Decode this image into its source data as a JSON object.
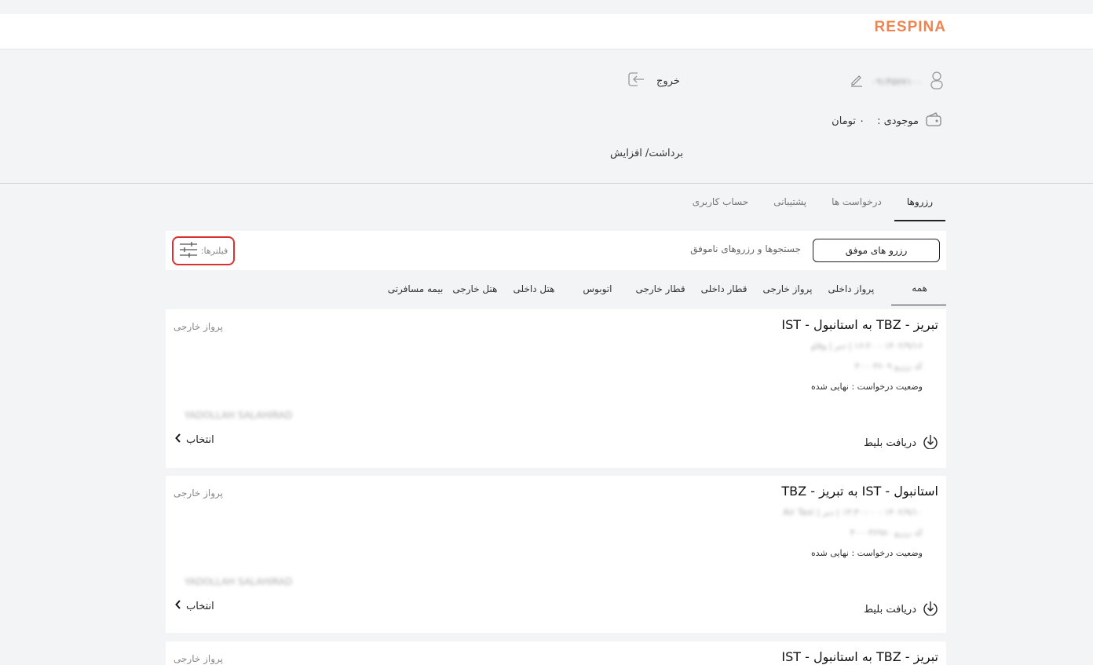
{
  "header": {
    "logo": "RESPINA"
  },
  "profile": {
    "phone": "۰۹۱۴۵۷۷۱۰۰",
    "logout_label": "خروج",
    "wallet_label": "موجودی :",
    "wallet_value": "۰ تومان",
    "withdraw_label": "برداشت/ افزایش"
  },
  "tabs": [
    {
      "label": "رزروها"
    },
    {
      "label": "درخواست ها"
    },
    {
      "label": "پشتیبانی"
    },
    {
      "label": "حساب کاربری"
    }
  ],
  "filterbar": {
    "success_label": "رزرو های موفق",
    "failed_label": "جستجوها و رزروهای ناموفق",
    "filters_label": "فیلترها:"
  },
  "categories": [
    {
      "label": "همه"
    },
    {
      "label": "پرواز داخلی"
    },
    {
      "label": "پرواز خارجی"
    },
    {
      "label": "قطار داخلی"
    },
    {
      "label": "قطار خارجی"
    },
    {
      "label": "اتوبوس"
    },
    {
      "label": "هتل داخلی"
    },
    {
      "label": "هتل خارجی"
    },
    {
      "label": "بیمه مسافرتی"
    }
  ],
  "bookings": [
    {
      "route": "تبریز - TBZ به استانبول - IST",
      "type": "پرواز خارجی",
      "date": "۱۴۰۲/۹/۱۶ - ۱۶:۲۰ | دیر | وقاو",
      "code": "کد رزرو ۳۰۰۰۳۶۰۹",
      "status": "وضعیت درخواست : نهایی شده",
      "passenger": "YADOLLAH SALAHIRAD",
      "select_label": "انتخاب",
      "ticket_label": "دریافت بلیط"
    },
    {
      "route": "استانبول - IST به تبریز - TBZ",
      "type": "پرواز خارجی",
      "date": "۱۴۰۲/۹/۱۰ - ۱۳:۳۰:۰۰ | دیر | Air Taxi",
      "code": "کد رزرو ۳۰۰۰۳۶۹۸۰",
      "status": "وضعیت درخواست : نهایی شده",
      "passenger": "YADOLLAH SALAHIRAD",
      "select_label": "انتخاب",
      "ticket_label": "دریافت بلیط"
    },
    {
      "route": "تبریز - TBZ به استانبول - IST",
      "type": "پرواز خارجی"
    }
  ]
}
